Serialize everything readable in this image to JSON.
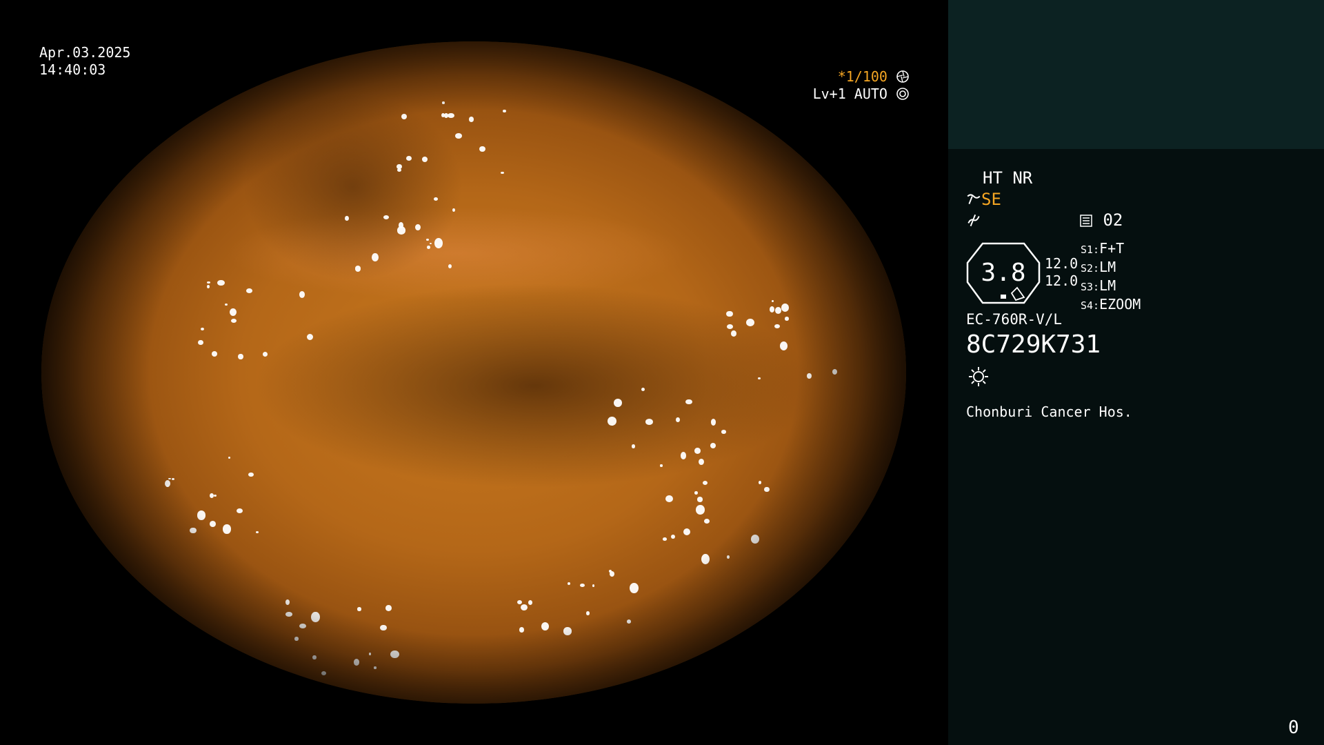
{
  "overlay": {
    "date": "Apr.03.2025",
    "time": "14:40:03",
    "shutter_prefix": "*",
    "shutter_speed": "1/100",
    "shutter_icon": "aperture-icon",
    "level_mode": "Lv+1 AUTO",
    "level_icon": "iris-icon"
  },
  "panel": {
    "ht_nr": "HT NR",
    "se_label": "SE",
    "se_icon": "tilde-hook-icon",
    "enhance_icon": "enhancement-icon",
    "scope_icon": "scope-list-icon",
    "scope_number": "02",
    "zoom_value": "3.8",
    "zoom_level_top": "12.0",
    "zoom_level_bottom": "12.0",
    "switches": [
      {
        "key": "S1:",
        "value": "F+T"
      },
      {
        "key": "S2:",
        "value": "LM"
      },
      {
        "key": "S3:",
        "value": "LM"
      },
      {
        "key": "S4:",
        "value": "EZOOM"
      }
    ],
    "model": "EC-760R-V/L",
    "serial": "8C729K731",
    "light_icon": "light-source-icon",
    "hospital": "Chonburi Cancer Hos.",
    "counter": "0"
  },
  "colors": {
    "accent_orange": "#f5a623",
    "panel_bg": "#050f0f",
    "panel_top_bg": "#0c2222"
  }
}
